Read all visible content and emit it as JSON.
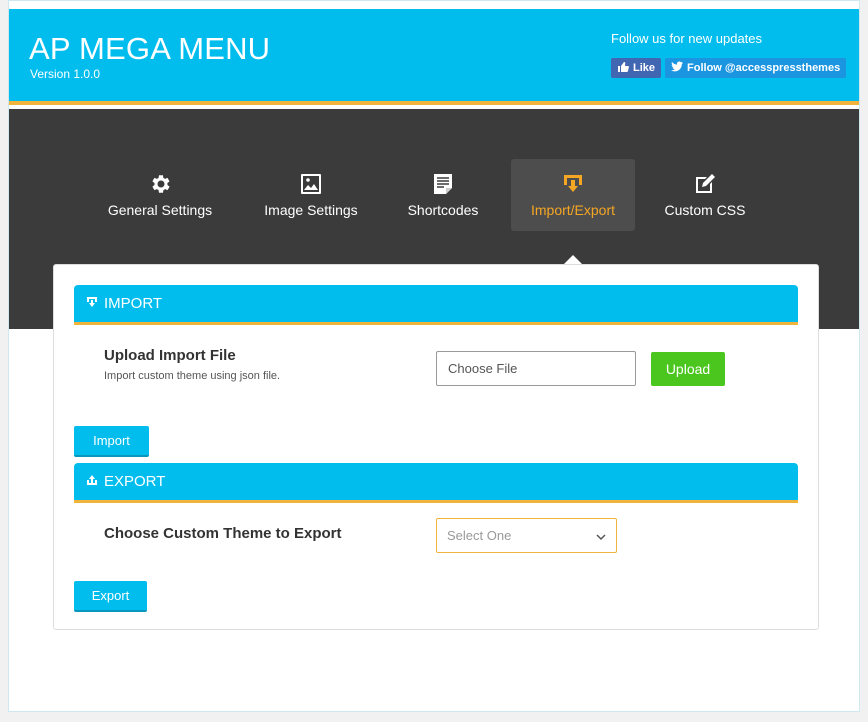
{
  "header": {
    "title": "AP MEGA MENU",
    "version": "Version 1.0.0",
    "follow_text": "Follow us for new updates",
    "like_label": "Like",
    "follow_label": "Follow @accesspressthemes"
  },
  "tabs": [
    {
      "label": "General Settings",
      "icon": "gear-icon"
    },
    {
      "label": "Image Settings",
      "icon": "image-icon"
    },
    {
      "label": "Shortcodes",
      "icon": "document-icon"
    },
    {
      "label": "Import/Export",
      "icon": "import-export-icon",
      "active": true
    },
    {
      "label": "Custom CSS",
      "icon": "edit-icon"
    }
  ],
  "import": {
    "heading": "IMPORT",
    "label": "Upload Import File",
    "description": "Import custom theme using json file.",
    "file_placeholder": "Choose File",
    "upload_label": "Upload",
    "button_label": "Import"
  },
  "export": {
    "heading": "EXPORT",
    "label": "Choose Custom Theme to Export",
    "select_value": "Select One",
    "button_label": "Export"
  },
  "colors": {
    "accent_blue": "#00bdee",
    "accent_gold": "#f0b43c",
    "active_orange": "#f5a623",
    "dark_band": "#3b3b3b",
    "upload_green": "#4bc61e"
  }
}
